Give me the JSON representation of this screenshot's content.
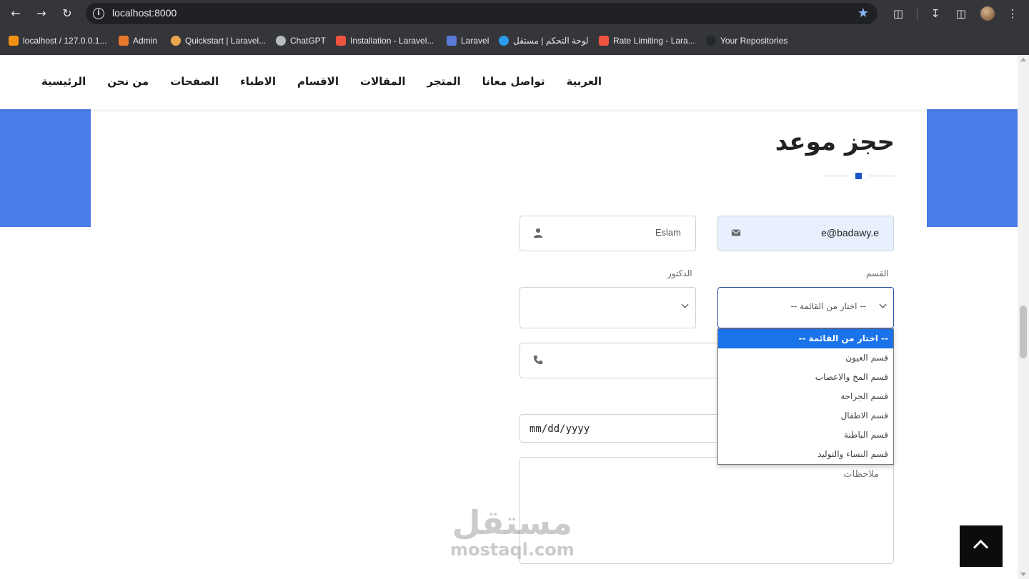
{
  "browser": {
    "url": "localhost:8000",
    "bookmarks": [
      {
        "label": "localhost / 127.0.0.1...",
        "color": "#f29111"
      },
      {
        "label": "Admin",
        "color": "#e8772e"
      },
      {
        "label": "Quickstart | Laravel...",
        "color": "#e9a64d"
      },
      {
        "label": "ChatGPT",
        "color": "#b8bcbf"
      },
      {
        "label": "Installation - Laravel...",
        "color": "#f05340"
      },
      {
        "label": "Laravel",
        "color": "#5a7bd8"
      },
      {
        "label": "لوحة التحكم | مستقل",
        "color": "#2d9cf0"
      },
      {
        "label": "Rate Limiting - Lara...",
        "color": "#f05340"
      },
      {
        "label": "Your Repositories",
        "color": "#24292e"
      }
    ]
  },
  "nav": {
    "items": [
      "الرئيسية",
      "من نحن",
      "الصفحات",
      "الاطباء",
      "الاقسام",
      "المقالات",
      "المتجر",
      "تواصل معانا",
      "العربية"
    ]
  },
  "form": {
    "title": "حجز موعد",
    "email_value": "e@badawy.e",
    "name_value": "Eslam",
    "department_label": "القسم",
    "doctor_label": "الدكتور",
    "department_selected": "-- اختار من القائمة --",
    "doctor_selected": "",
    "phone_value": "",
    "date_value": "mm/dd/yyyy",
    "notes_placeholder": "ملاحظات"
  },
  "dropdown": {
    "options": [
      "-- اختار من القائمة --",
      "قسم العيون",
      "قسم المخ والاعصاب",
      "قسم الجراحة",
      "قسم الاطفال",
      "قسم الباطنة",
      "قسم النساء والتوليد"
    ],
    "selected_index": 0
  },
  "watermark": {
    "arabic": "مستقل",
    "latin": "mostaql.com"
  },
  "colors": {
    "accent_blue": "#4b7be6",
    "divider_dot": "#1753c9",
    "selected_option": "#1a73e8"
  }
}
